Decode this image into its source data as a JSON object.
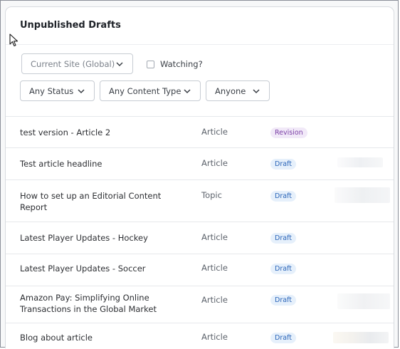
{
  "panel": {
    "title": "Unpublished Drafts"
  },
  "filters": {
    "site": "Current Site (Global)",
    "watching": "Watching?",
    "status": "Any Status",
    "content_type": "Any Content Type",
    "user": "Anyone"
  },
  "rows": [
    {
      "title": "test version - Article 2",
      "type": "Article",
      "status": "Revision"
    },
    {
      "title": "Test article headline",
      "type": "Article",
      "status": "Draft"
    },
    {
      "title": "How to set up an Editorial Content Report",
      "type": "Topic",
      "status": "Draft"
    },
    {
      "title": "Latest Player Updates - Hockey",
      "type": "Article",
      "status": "Draft"
    },
    {
      "title": "Latest Player Updates - Soccer",
      "type": "Article",
      "status": "Draft"
    },
    {
      "title": "Amazon Pay: Simplifying Online Transactions in the Global Market",
      "type": "Article",
      "status": "Draft"
    },
    {
      "title": "Blog about article",
      "type": "Article",
      "status": "Draft"
    }
  ],
  "colors": {
    "draft_bg": "#e6f0fb",
    "draft_fg": "#2a64b8",
    "revision_bg": "#f1e9f8",
    "revision_fg": "#7b3fa6"
  }
}
